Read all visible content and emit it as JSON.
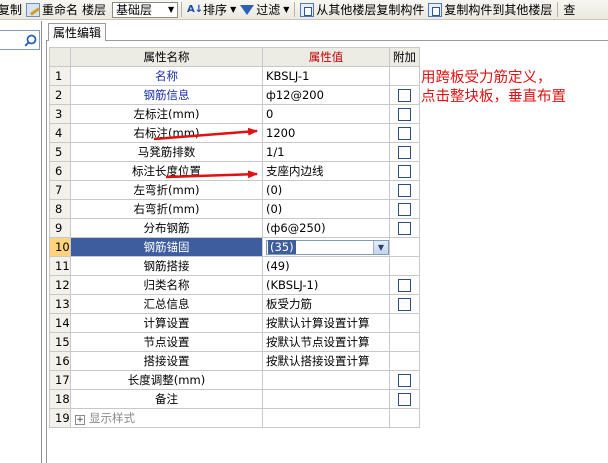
{
  "toolbar": {
    "items": {
      "copy_left": "复制",
      "rename": "重命名",
      "floor_label": "楼层",
      "floor_value": "基础层",
      "sort": "排序",
      "filter": "过滤",
      "copy_from_floor": "从其他楼层复制构件",
      "copy_to_floor": "复制构件到其他楼层",
      "query": "查"
    }
  },
  "properties_panel": {
    "tab_label": "属性编辑",
    "columns": {
      "name": "属性名称",
      "value": "属性值",
      "extra": "附加"
    },
    "rows": [
      {
        "index": "1",
        "name": "名称",
        "value": "KBSLJ-1",
        "checkbox": false,
        "name_color": "blue"
      },
      {
        "index": "2",
        "name": "钢筋信息",
        "value": "ф12@200",
        "checkbox": true,
        "name_color": "blue"
      },
      {
        "index": "3",
        "name": "左标注(mm)",
        "value": "0",
        "checkbox": true,
        "name_color": "black"
      },
      {
        "index": "4",
        "name": "右标注(mm)",
        "value": "1200",
        "checkbox": true,
        "name_color": "black"
      },
      {
        "index": "5",
        "name": "马凳筋排数",
        "value": "1/1",
        "checkbox": true,
        "name_color": "black"
      },
      {
        "index": "6",
        "name": "标注长度位置",
        "value": "支座内边线",
        "checkbox": true,
        "name_color": "black"
      },
      {
        "index": "7",
        "name": "左弯折(mm)",
        "value": "(0)",
        "checkbox": true,
        "name_color": "black"
      },
      {
        "index": "8",
        "name": "右弯折(mm)",
        "value": "(0)",
        "checkbox": true,
        "name_color": "black"
      },
      {
        "index": "9",
        "name": "分布钢筋",
        "value": "(ф6@250)",
        "checkbox": true,
        "name_color": "black"
      },
      {
        "index": "10",
        "name": "钢筋锚固",
        "value": "(35)",
        "checkbox": false,
        "name_color": "black"
      },
      {
        "index": "11",
        "name": "钢筋搭接",
        "value": "(49)",
        "checkbox": false,
        "name_color": "black"
      },
      {
        "index": "12",
        "name": "归类名称",
        "value": "(KBSLJ-1)",
        "checkbox": true,
        "name_color": "black"
      },
      {
        "index": "13",
        "name": "汇总信息",
        "value": "板受力筋",
        "checkbox": true,
        "name_color": "black"
      },
      {
        "index": "14",
        "name": "计算设置",
        "value": "按默认计算设置计算",
        "checkbox": false,
        "name_color": "black"
      },
      {
        "index": "15",
        "name": "节点设置",
        "value": "按默认节点设置计算",
        "checkbox": false,
        "name_color": "black"
      },
      {
        "index": "16",
        "name": "搭接设置",
        "value": "按默认搭接设置计算",
        "checkbox": false,
        "name_color": "black"
      },
      {
        "index": "17",
        "name": "长度调整(mm)",
        "value": "",
        "checkbox": true,
        "name_color": "black"
      },
      {
        "index": "18",
        "name": "备注",
        "value": "",
        "checkbox": true,
        "name_color": "black"
      },
      {
        "index": "19",
        "name": "显示样式",
        "value": "",
        "checkbox": false,
        "name_color": "gray",
        "expandable": true
      }
    ],
    "selected_row": "10"
  },
  "annotation": {
    "line1": "用跨板受力筋定义，",
    "line2": "点击整块板，垂直布置"
  },
  "colors": {
    "annotation_red": "#e21010",
    "selection_blue": "#3d5d9e",
    "header_value_bg": "#fce3a8"
  },
  "icons": {
    "search": "search-icon",
    "rename": "rename-icon",
    "sort": "sort-icon",
    "filter": "filter-icon",
    "copy_from": "copy-from-floor-icon",
    "copy_to": "copy-to-floor-icon",
    "dropdown": "chevron-down-icon",
    "expand": "plus-icon"
  }
}
